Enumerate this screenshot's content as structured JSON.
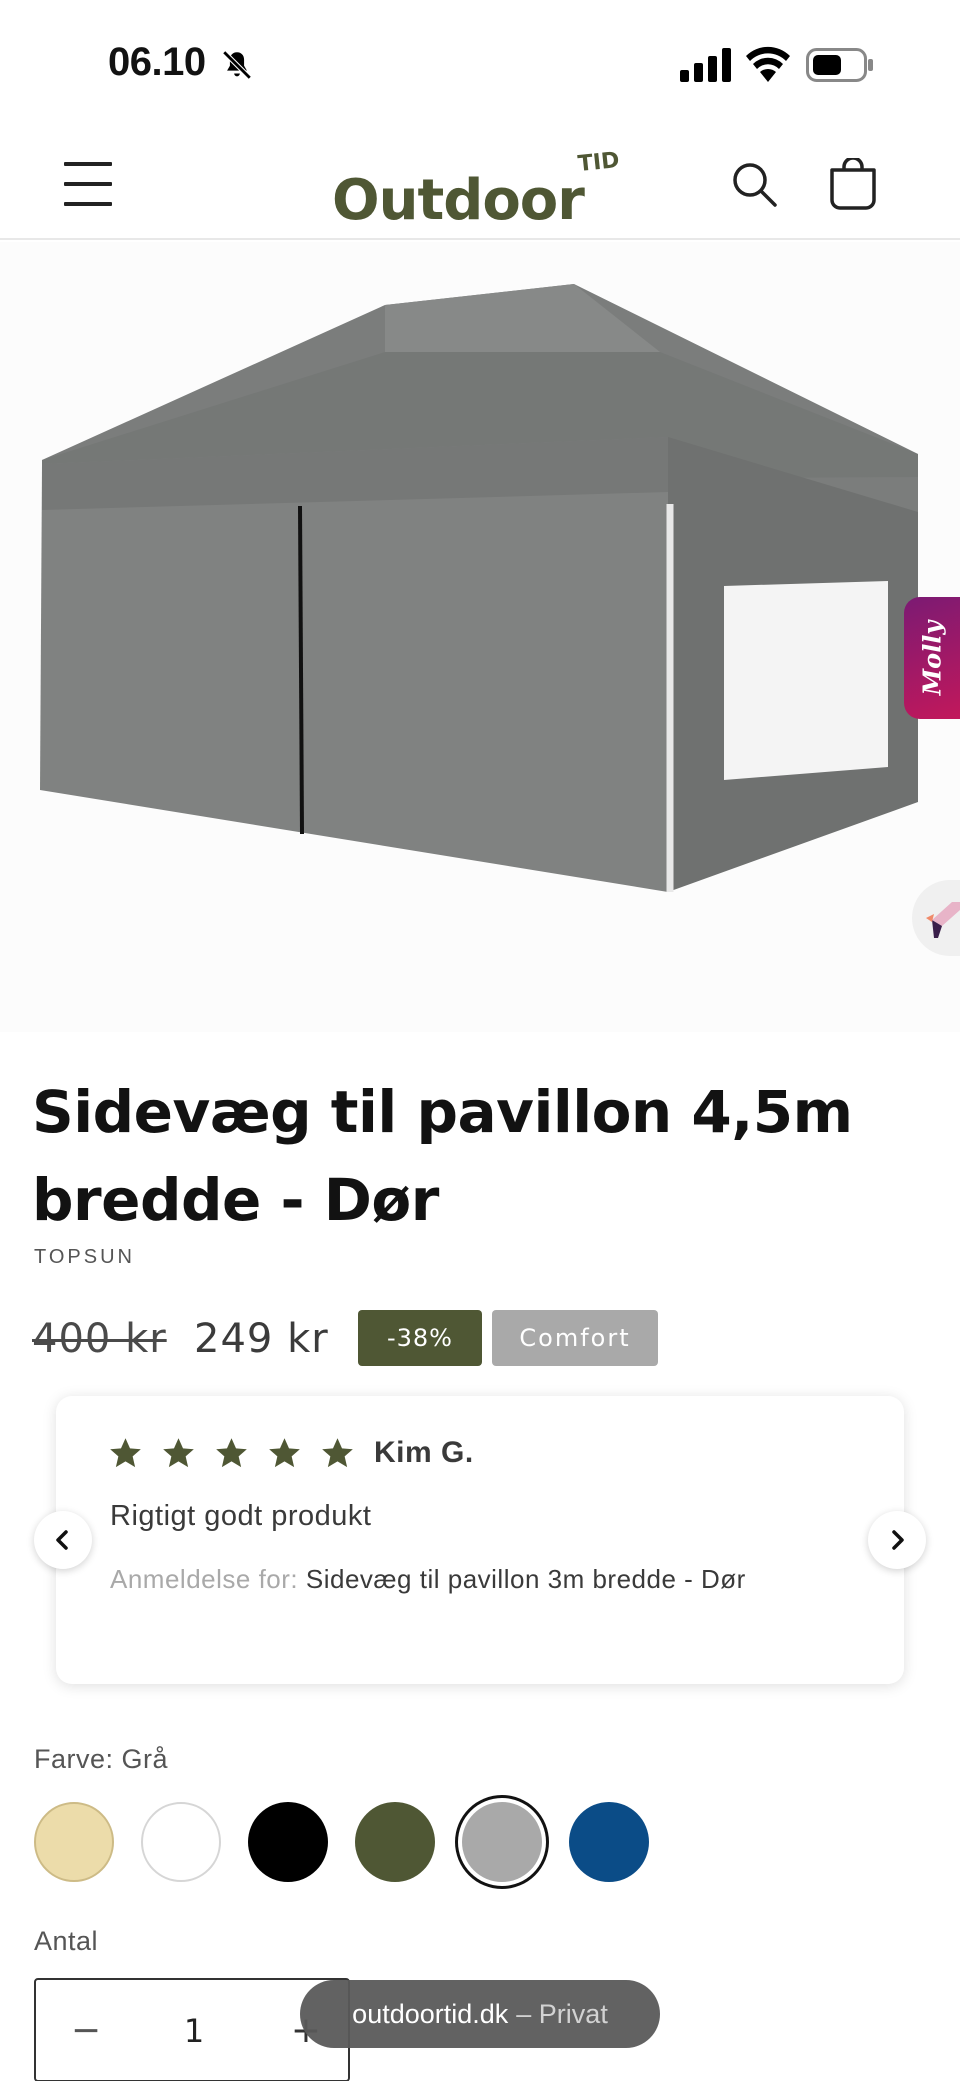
{
  "status_bar": {
    "time": "06.10",
    "icons": [
      "bell-slash-icon",
      "cellular-signal-icon",
      "wifi-icon",
      "battery-icon"
    ]
  },
  "header": {
    "logo_text": "Outdoor",
    "logo_sup": "TID",
    "brand_color": "#4f5734",
    "icons": [
      "hamburger-menu-icon",
      "search-icon",
      "cart-icon"
    ]
  },
  "product": {
    "image_alt": "Grey pop-up pavilion with side walls, door and window",
    "molly_label": "Molly",
    "title": "Sidevæg til pavillon 4,5m bredde - Dør",
    "vendor": "TOPSUN",
    "price_old": "400 kr",
    "price_new": "249 kr",
    "badge_sale": "-38%",
    "badge_comfort": "Comfort"
  },
  "review": {
    "rating": 5,
    "reviewer": "Kim G.",
    "text": "Rigtigt godt produkt",
    "for_label": "Anmeldelse for:",
    "for_product": "Sidevæg til pavillon 3m bredde - Dør",
    "star_color": "#4f5734"
  },
  "color_option": {
    "label": "Farve: Grå",
    "swatches": [
      {
        "name": "beige",
        "color": "#ecdcaa",
        "selected": false
      },
      {
        "name": "white",
        "color": "#ffffff",
        "selected": false
      },
      {
        "name": "black",
        "color": "#000000",
        "selected": false
      },
      {
        "name": "olive",
        "color": "#4f5734",
        "selected": false
      },
      {
        "name": "grey",
        "color": "#a9a9a9",
        "selected": true
      },
      {
        "name": "blue",
        "color": "#0b4c87",
        "selected": false
      }
    ]
  },
  "quantity": {
    "label": "Antal",
    "value": "1",
    "minus": "−",
    "plus": "+"
  },
  "browser": {
    "url": "outdoortid.dk",
    "mode": "– Privat"
  }
}
